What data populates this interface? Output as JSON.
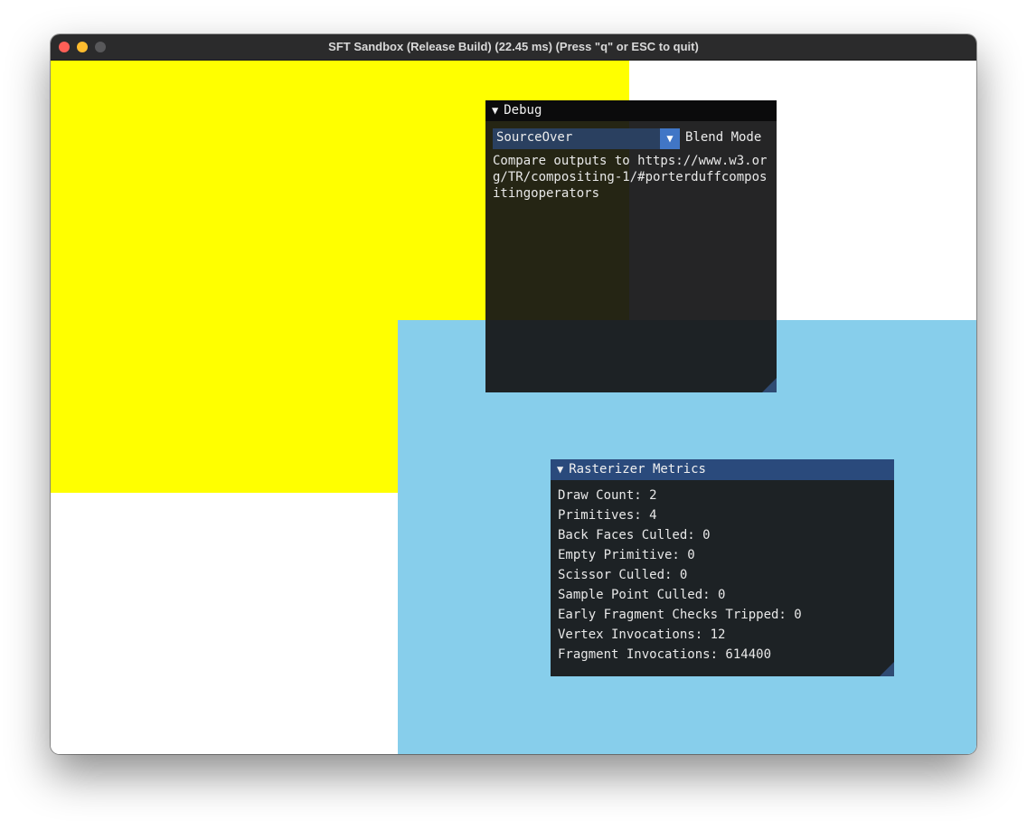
{
  "window": {
    "title": "SFT Sandbox (Release Build) (22.45 ms) (Press \"q\" or ESC to quit)"
  },
  "scene": {
    "yellow_color": "#ffff00",
    "blue_color": "#87ceeb"
  },
  "debug": {
    "title": "Debug",
    "blend_mode_value": "SourceOver",
    "blend_mode_label": "Blend Mode",
    "compare_text": "Compare outputs to https://www.w3.org/TR/compositing-1/#porterduffcompositingoperators"
  },
  "metrics": {
    "title": "Rasterizer Metrics",
    "lines": [
      "Draw Count: 2",
      "Primitives: 4",
      "Back Faces Culled: 0",
      "Empty Primitive: 0",
      "Scissor Culled: 0",
      "Sample Point Culled: 0",
      "Early Fragment Checks Tripped: 0",
      "Vertex Invocations: 12",
      "Fragment Invocations: 614400"
    ]
  },
  "icons": {
    "collapse": "triangle-down-icon",
    "combo_arrow": "chevron-down-icon"
  }
}
